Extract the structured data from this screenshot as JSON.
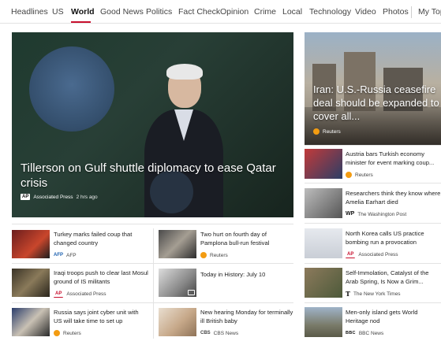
{
  "nav": {
    "items": [
      "Headlines",
      "US",
      "World",
      "Good News",
      "Politics",
      "Fact Check",
      "Opinion",
      "Crime",
      "Local",
      "Technology",
      "Video",
      "Photos",
      "My Top"
    ],
    "active": "World"
  },
  "hero": {
    "title": "Tillerson on Gulf shuttle diplomacy to ease Qatar crisis",
    "source": "Associated Press",
    "time": "2 hrs ago",
    "badge": "AP"
  },
  "side_feature": {
    "title": "Iran: U.S.-Russia ceasefire deal should be expanded to cover all...",
    "source": "Reuters"
  },
  "right_list": [
    {
      "headline": "Austria bars Turkish economy minister for event marking coup...",
      "source": "Reuters",
      "badge": "reuters"
    },
    {
      "headline": "Researchers think they know where Amelia Earhart died",
      "source": "The Washington Post",
      "badge": "wp"
    },
    {
      "headline": "North Korea calls US practice bombing run a provocation",
      "source": "Associated Press",
      "badge": "ap"
    },
    {
      "headline": "Self-Immolation, Catalyst of the Arab Spring, Is Now a Grim...",
      "source": "The New York Times",
      "badge": "nyt"
    },
    {
      "headline": "Men-only island gets World Heritage nod",
      "source": "BBC News",
      "badge": "bbc"
    }
  ],
  "grid": [
    {
      "headline": "Turkey marks failed coup that changed country",
      "source": "AFP",
      "badge": "afp"
    },
    {
      "headline": "Two hurt on fourth day of Pamplona bull-run festival",
      "source": "Reuters",
      "badge": "reuters"
    },
    {
      "headline": "Iraqi troops push to clear last Mosul ground of IS militants",
      "source": "Associated Press",
      "badge": "ap"
    },
    {
      "headline": "Today in History: July 10",
      "source": "",
      "badge": ""
    },
    {
      "headline": "Russia says joint cyber unit with US will take time to set up",
      "source": "Reuters",
      "badge": "reuters"
    },
    {
      "headline": "New hearing Monday for terminally ill British baby",
      "source": "CBS News",
      "badge": "cbs"
    }
  ],
  "badges": {
    "ap": "AP",
    "afp": "AFP",
    "wp": "WP",
    "nyt": "T",
    "bbc": "BBC",
    "cbs": "CBS"
  },
  "colors": {
    "accent": "#c8102e",
    "reuters": "#f39c12",
    "afp": "#1b5fae"
  }
}
